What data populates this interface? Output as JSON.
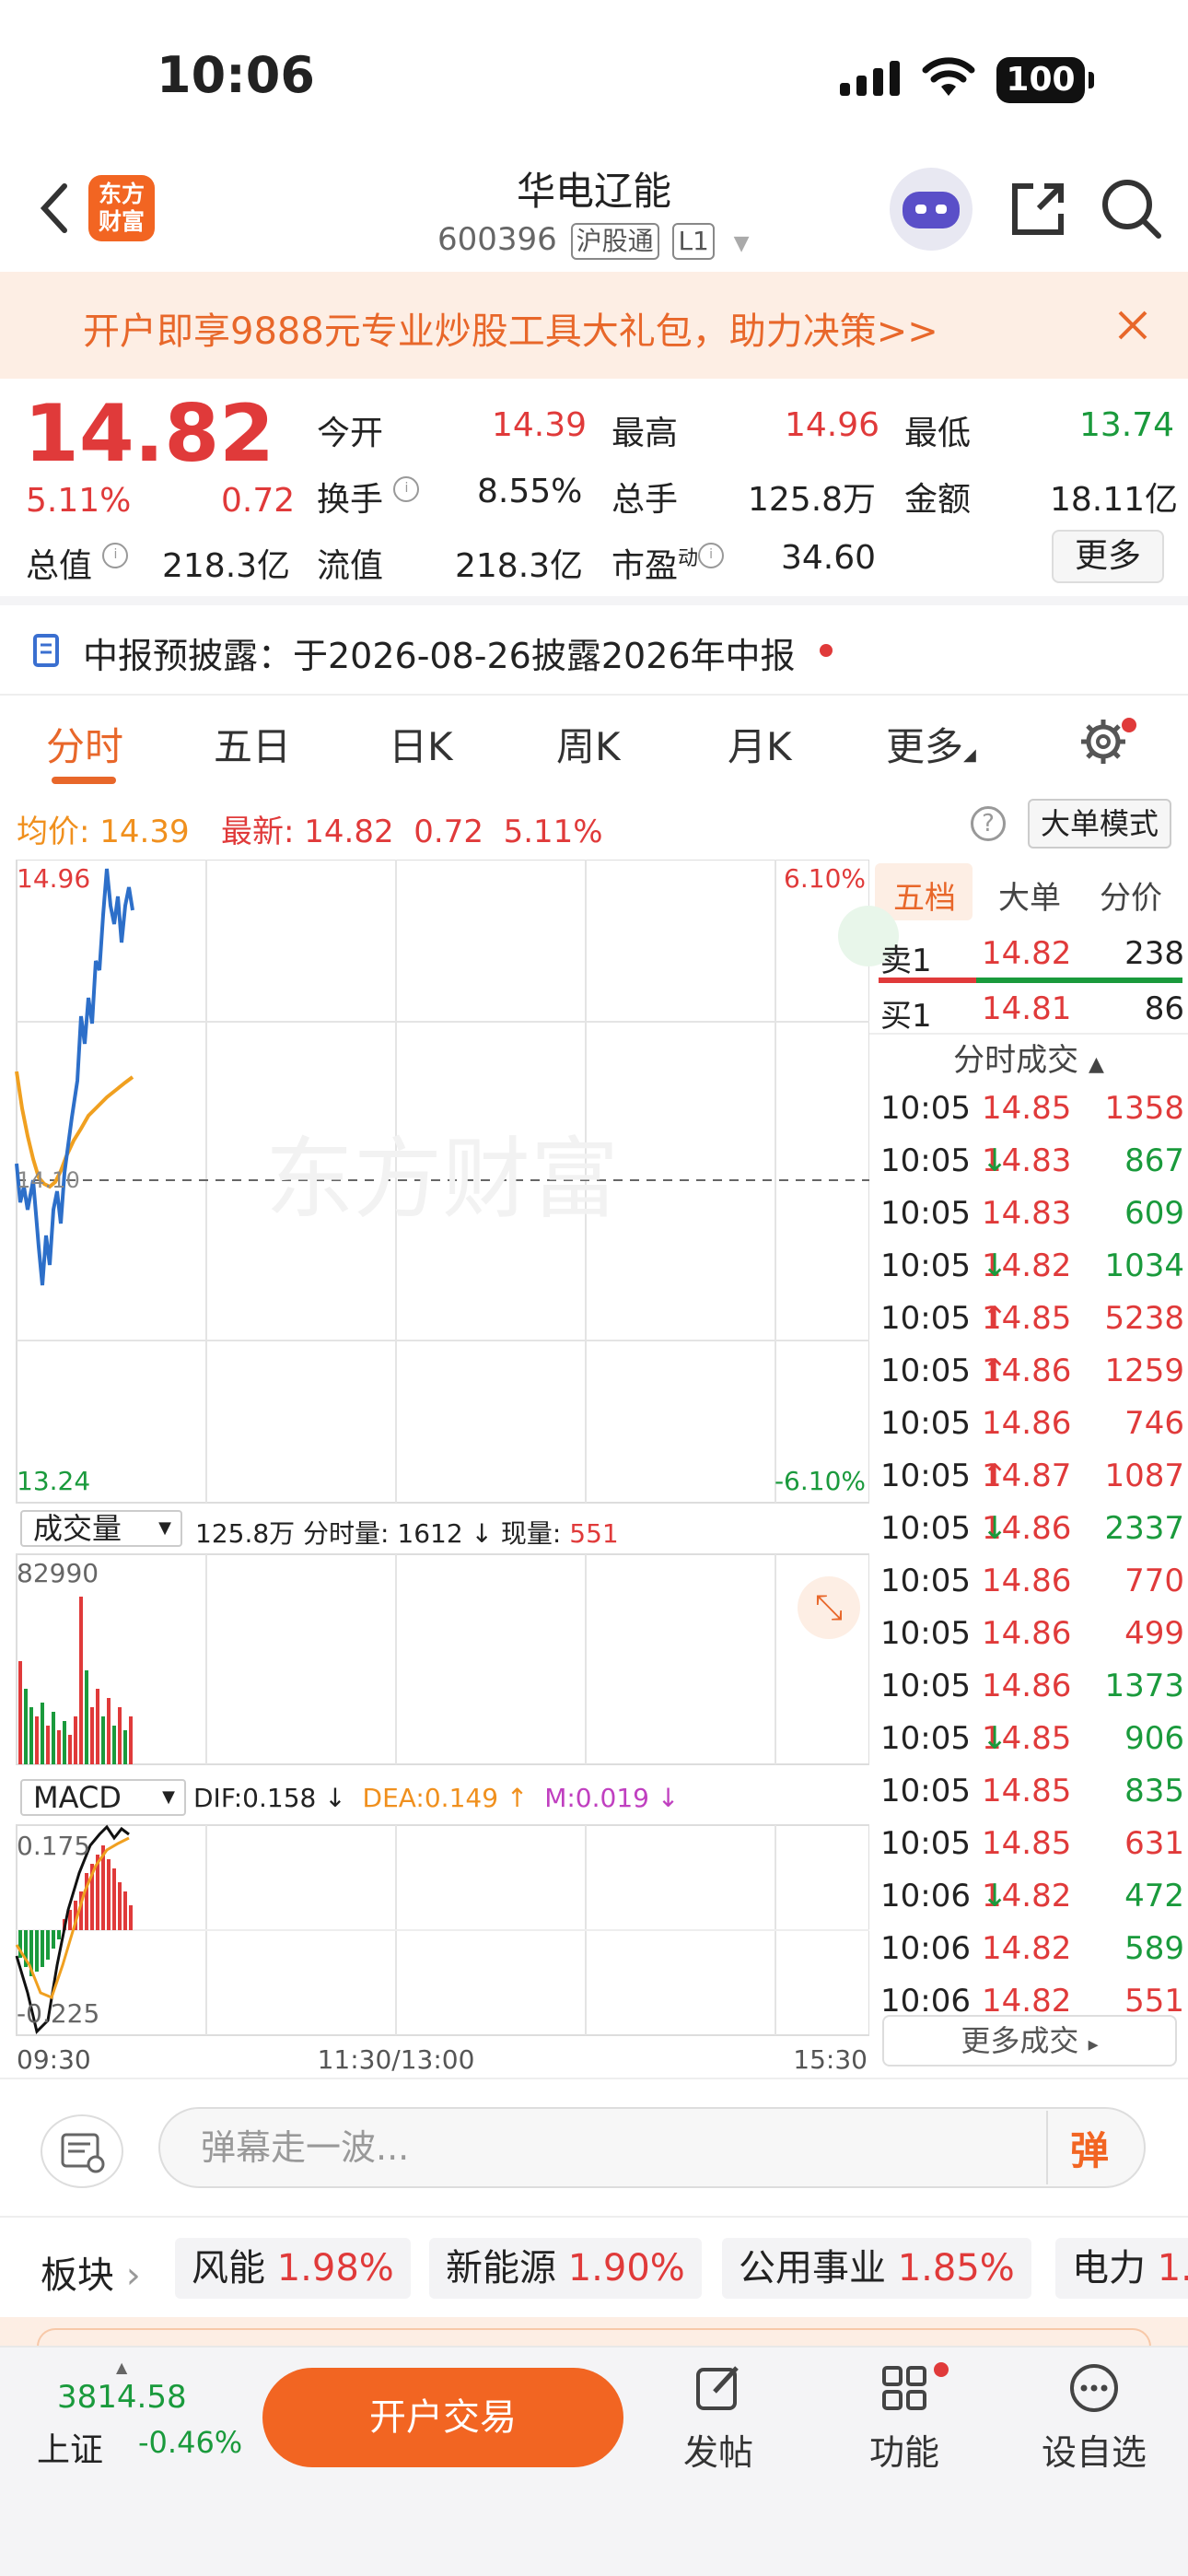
{
  "status": {
    "time": "10:06",
    "battery": "100"
  },
  "nav": {
    "title": "华电辽能",
    "code": "600396",
    "tag1": "沪股通",
    "tag2": "L1",
    "logo_line1": "东方",
    "logo_line2": "财富"
  },
  "promo": {
    "text": "开户即享9888元专业炒股工具大礼包，助力决策>>"
  },
  "quote": {
    "price": "14.82",
    "pct": "5.11%",
    "chg": "0.72",
    "labels": {
      "open": "今开",
      "high": "最高",
      "low": "最低",
      "turnover": "换手",
      "vol": "总手",
      "amount": "金额",
      "mktcap": "总值",
      "float": "流值",
      "pe": "市盈",
      "pe_sup": "动"
    },
    "values": {
      "open": "14.39",
      "high": "14.96",
      "low": "13.74",
      "turnover": "8.55%",
      "vol": "125.8万",
      "amount": "18.11亿",
      "mktcap": "218.3亿",
      "float": "218.3亿",
      "pe": "34.60"
    },
    "more": "更多"
  },
  "notice": {
    "text": "中报预披露：于2026-08-26披露2026年中报"
  },
  "tabs": [
    "分时",
    "五日",
    "日K",
    "周K",
    "月K",
    "更多"
  ],
  "avgbar": {
    "avg_label": "均价:",
    "avg": "14.39",
    "latest_label": "最新:",
    "latest": "14.82",
    "chg": "0.72",
    "pct": "5.11%",
    "mode_btn": "大单模式",
    "help": "?"
  },
  "chart": {
    "watermark": "东方财富",
    "top_left": "14.96",
    "top_right": "6.10%",
    "bottom_left": "13.24",
    "bottom_right": "-6.10%",
    "mid_label": "14.10",
    "vol_dropdown": "成交量",
    "vol_info": "125.8万 分时量: 1612 ↓ 现量:",
    "vol_now": "551",
    "vol_max": "82990",
    "macd_dropdown": "MACD",
    "dif": "DIF:0.158 ↓",
    "dea": "DEA:0.149 ↑",
    "m": "M:0.019 ↓",
    "macd_top": "0.175",
    "macd_bottom": "-0.225",
    "x_start": "09:30",
    "x_mid": "11:30/13:00",
    "x_end": "15:30"
  },
  "book": {
    "tabs": [
      "五档",
      "大单",
      "分价"
    ],
    "sell1": {
      "label": "卖1",
      "price": "14.82",
      "qty": "238"
    },
    "buy1": {
      "label": "买1",
      "price": "14.81",
      "qty": "86"
    },
    "ticks_header": "分时成交",
    "ticks": [
      {
        "t": "10:05",
        "p": "14.85",
        "a": "",
        "q": "1358",
        "c": "red"
      },
      {
        "t": "10:05",
        "p": "14.83",
        "a": "↓",
        "q": "867",
        "c": "green"
      },
      {
        "t": "10:05",
        "p": "14.83",
        "a": "",
        "q": "609",
        "c": "green"
      },
      {
        "t": "10:05",
        "p": "14.82",
        "a": "↓",
        "q": "1034",
        "c": "green"
      },
      {
        "t": "10:05",
        "p": "14.85",
        "a": "↑",
        "q": "5238",
        "c": "red"
      },
      {
        "t": "10:05",
        "p": "14.86",
        "a": "↑",
        "q": "1259",
        "c": "red"
      },
      {
        "t": "10:05",
        "p": "14.86",
        "a": "",
        "q": "746",
        "c": "red"
      },
      {
        "t": "10:05",
        "p": "14.87",
        "a": "↑",
        "q": "1087",
        "c": "red"
      },
      {
        "t": "10:05",
        "p": "14.86",
        "a": "↓",
        "q": "2337",
        "c": "green"
      },
      {
        "t": "10:05",
        "p": "14.86",
        "a": "",
        "q": "770",
        "c": "red"
      },
      {
        "t": "10:05",
        "p": "14.86",
        "a": "",
        "q": "499",
        "c": "red"
      },
      {
        "t": "10:05",
        "p": "14.86",
        "a": "",
        "q": "1373",
        "c": "green"
      },
      {
        "t": "10:05",
        "p": "14.85",
        "a": "↓",
        "q": "906",
        "c": "green"
      },
      {
        "t": "10:05",
        "p": "14.85",
        "a": "",
        "q": "835",
        "c": "green"
      },
      {
        "t": "10:05",
        "p": "14.85",
        "a": "",
        "q": "631",
        "c": "red"
      },
      {
        "t": "10:06",
        "p": "14.82",
        "a": "↓",
        "q": "472",
        "c": "green"
      },
      {
        "t": "10:06",
        "p": "14.82",
        "a": "",
        "q": "589",
        "c": "green"
      },
      {
        "t": "10:06",
        "p": "14.82",
        "a": "",
        "q": "551",
        "c": "red"
      }
    ],
    "more": "更多成交"
  },
  "comment": {
    "placeholder": "弹幕走一波...",
    "danmu": "弹"
  },
  "sectors": {
    "label": "板块",
    "items": [
      {
        "name": "风能",
        "pct": "1.98%"
      },
      {
        "name": "新能源",
        "pct": "1.90%"
      },
      {
        "name": "公用事业",
        "pct": "1.85%"
      },
      {
        "name": "电力",
        "pct": "1."
      }
    ]
  },
  "bottom": {
    "index_val": "3814.58",
    "index_name": "上证",
    "index_pct": "-0.46%",
    "trade": "开户交易",
    "post": "发帖",
    "func": "功能",
    "watch": "设自选"
  },
  "colors": {
    "accent": "#f26522",
    "up": "#e03a3a",
    "down": "#1a9a3c",
    "avg_line": "#f0a020",
    "price_line": "#2d6fc9"
  }
}
